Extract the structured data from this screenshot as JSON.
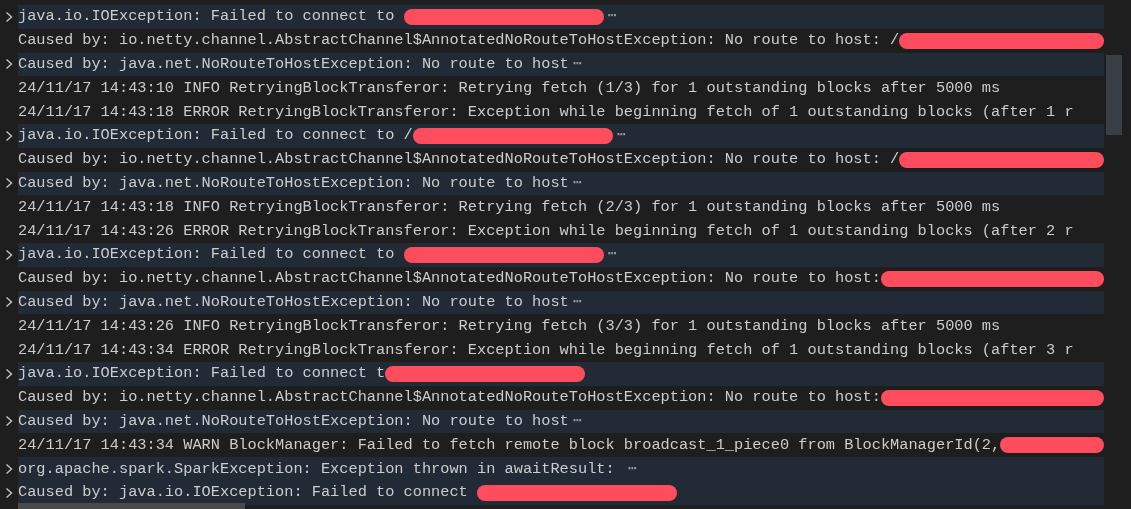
{
  "lines": [
    {
      "text": "java.io.IOException: Failed to connect to ",
      "collapsible": true,
      "redacted": true,
      "ellipsis": "⋯"
    },
    {
      "text": "Caused by: io.netty.channel.AbstractChannel$AnnotatedNoRouteToHostException: No route to host: /",
      "collapsible": false,
      "redacted": true
    },
    {
      "text": "Caused by: java.net.NoRouteToHostException: No route to host",
      "collapsible": true,
      "ellipsis": "⋯"
    },
    {
      "text": "24/11/17 14:43:10 INFO RetryingBlockTransferor: Retrying fetch (1/3) for 1 outstanding blocks after 5000 ms",
      "collapsible": false
    },
    {
      "text": "24/11/17 14:43:18 ERROR RetryingBlockTransferor: Exception while beginning fetch of 1 outstanding blocks (after 1 r",
      "collapsible": false
    },
    {
      "text": "java.io.IOException: Failed to connect to /",
      "collapsible": true,
      "redacted": true,
      "ellipsis": "⋯"
    },
    {
      "text": "Caused by: io.netty.channel.AbstractChannel$AnnotatedNoRouteToHostException: No route to host: /",
      "collapsible": false,
      "redacted": true
    },
    {
      "text": "Caused by: java.net.NoRouteToHostException: No route to host",
      "collapsible": true,
      "ellipsis": "⋯"
    },
    {
      "text": "24/11/17 14:43:18 INFO RetryingBlockTransferor: Retrying fetch (2/3) for 1 outstanding blocks after 5000 ms",
      "collapsible": false
    },
    {
      "text": "24/11/17 14:43:26 ERROR RetryingBlockTransferor: Exception while beginning fetch of 1 outstanding blocks (after 2 r",
      "collapsible": false
    },
    {
      "text": "java.io.IOException: Failed to connect to ",
      "collapsible": true,
      "redacted": true,
      "ellipsis": "⋯"
    },
    {
      "text": "Caused by: io.netty.channel.AbstractChannel$AnnotatedNoRouteToHostException: No route to host:",
      "collapsible": false,
      "redacted": true
    },
    {
      "text": "Caused by: java.net.NoRouteToHostException: No route to host",
      "collapsible": true,
      "ellipsis": "⋯"
    },
    {
      "text": "24/11/17 14:43:26 INFO RetryingBlockTransferor: Retrying fetch (3/3) for 1 outstanding blocks after 5000 ms",
      "collapsible": false
    },
    {
      "text": "24/11/17 14:43:34 ERROR RetryingBlockTransferor: Exception while beginning fetch of 1 outstanding blocks (after 3 r",
      "collapsible": false
    },
    {
      "text": "java.io.IOException: Failed to connect t",
      "collapsible": true,
      "redacted": true
    },
    {
      "text": "Caused by: io.netty.channel.AbstractChannel$AnnotatedNoRouteToHostException: No route to host:",
      "collapsible": false,
      "redacted": true
    },
    {
      "text": "Caused by: java.net.NoRouteToHostException: No route to host",
      "collapsible": true,
      "ellipsis": "⋯"
    },
    {
      "text": "24/11/17 14:43:34 WARN BlockManager: Failed to fetch remote block broadcast_1_piece0 from BlockManagerId(2,",
      "collapsible": false,
      "redacted": true
    },
    {
      "text": "org.apache.spark.SparkException: Exception thrown in awaitResult: ",
      "collapsible": true,
      "ellipsis": "⋯"
    },
    {
      "text": "Caused by: java.io.IOException: Failed to connect ",
      "collapsible": true,
      "redacted": true
    }
  ]
}
